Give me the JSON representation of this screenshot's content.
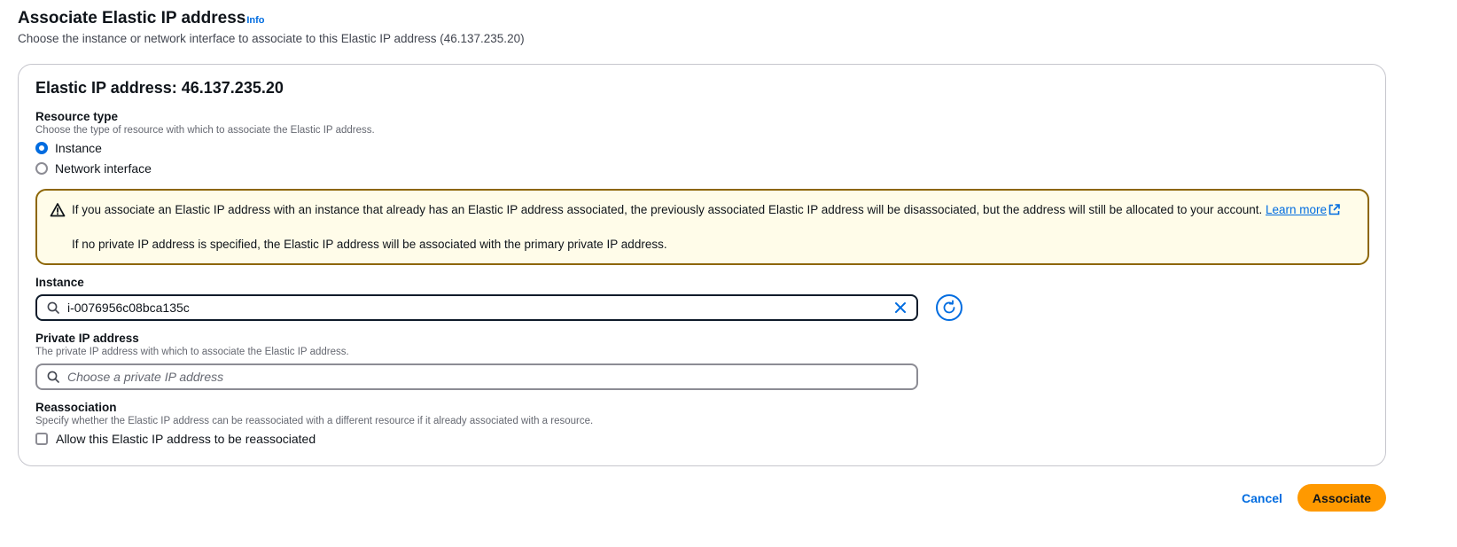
{
  "header": {
    "title": "Associate Elastic IP address",
    "info_label": "Info",
    "description": "Choose the instance or network interface to associate to this Elastic IP address (46.137.235.20)"
  },
  "panel": {
    "title": "Elastic IP address: 46.137.235.20"
  },
  "resource_type": {
    "label": "Resource type",
    "description": "Choose the type of resource with which to associate the Elastic IP address.",
    "options": [
      {
        "label": "Instance",
        "selected": true
      },
      {
        "label": "Network interface",
        "selected": false
      }
    ]
  },
  "alert": {
    "type": "warning",
    "message": "If you associate an Elastic IP address with an instance that already has an Elastic IP address associated, the previously associated Elastic IP address will be disassociated, but the address will still be allocated to your account.",
    "link_label": "Learn more",
    "message2": "If no private IP address is specified, the Elastic IP address will be associated with the primary private IP address."
  },
  "instance": {
    "label": "Instance",
    "value": "i-0076956c08bca135c"
  },
  "private_ip": {
    "label": "Private IP address",
    "description": "The private IP address with which to associate the Elastic IP address.",
    "placeholder": "Choose a private IP address"
  },
  "reassociation": {
    "label": "Reassociation",
    "description": "Specify whether the Elastic IP address can be reassociated with a different resource if it already associated with a resource.",
    "checkbox_label": "Allow this Elastic IP address to be reassociated",
    "checked": false
  },
  "actions": {
    "cancel_label": "Cancel",
    "submit_label": "Associate"
  },
  "colors": {
    "link": "#006ce0",
    "primary_button": "#ff9900",
    "warning_border": "#8d6605",
    "warning_bg": "#fffce9"
  }
}
